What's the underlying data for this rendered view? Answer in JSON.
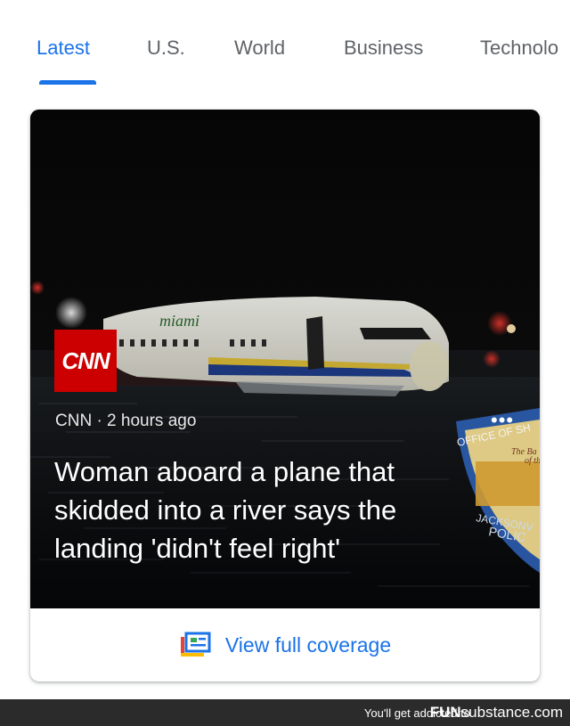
{
  "tabs": [
    {
      "label": "Latest",
      "active": true
    },
    {
      "label": "U.S.",
      "active": false
    },
    {
      "label": "World",
      "active": false
    },
    {
      "label": "Business",
      "active": false
    },
    {
      "label": "Technolo",
      "active": false
    }
  ],
  "article": {
    "source_logo_text": "CNN",
    "meta": "CNN · 2 hours ago",
    "headline": "Woman aboard a plane that skidded into a river says the landing 'didn't feel right'",
    "more_label": "•••",
    "image_text": {
      "plane_livery": "miami",
      "badge_top": "OFFICE OF SH",
      "badge_bottom_1": "JACKSONV",
      "badge_bottom_2": "POLIC",
      "badge_inner": "The Ba",
      "badge_inner_2": "of the"
    }
  },
  "coverage": {
    "label": "View full coverage",
    "icon": "full-coverage-icon"
  },
  "watermark": {
    "text": "You'll get addicted to",
    "brand_bold": "FUN",
    "brand_light": "substance",
    "brand_suffix": ".com"
  },
  "colors": {
    "accent": "#1a73e8",
    "cnn_red": "#cc0000",
    "footer_bg": "#2b2b2b"
  }
}
